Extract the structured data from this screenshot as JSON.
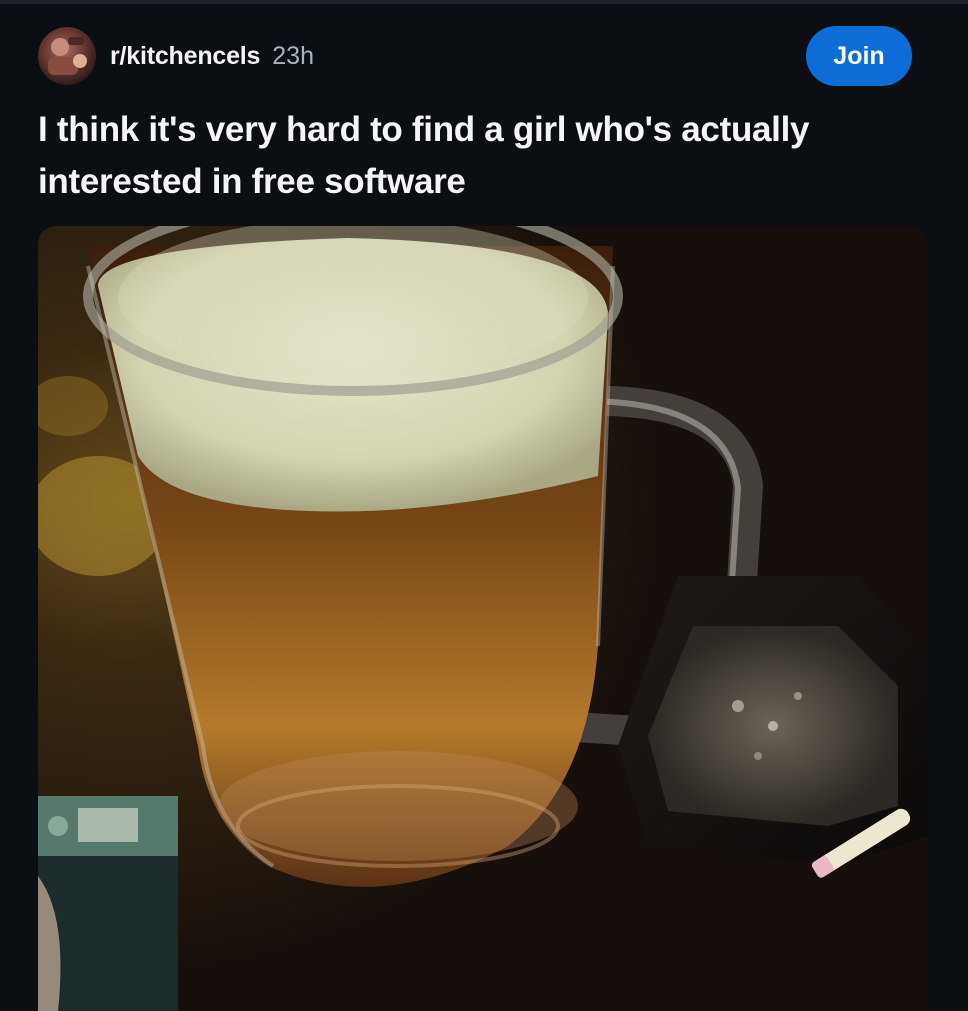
{
  "post": {
    "community": "r/kitchencels",
    "age": "23h",
    "join_label": "Join",
    "title": "I think it's very hard to find a girl who's actually interested in free software"
  },
  "icons": {
    "avatar": "community-avatar",
    "image": "beer-mug-photo"
  },
  "colors": {
    "background": "#0b0f14",
    "join_button": "#0d6dd6",
    "text_primary": "#f2f4f5",
    "text_secondary": "#a8b3bd"
  }
}
